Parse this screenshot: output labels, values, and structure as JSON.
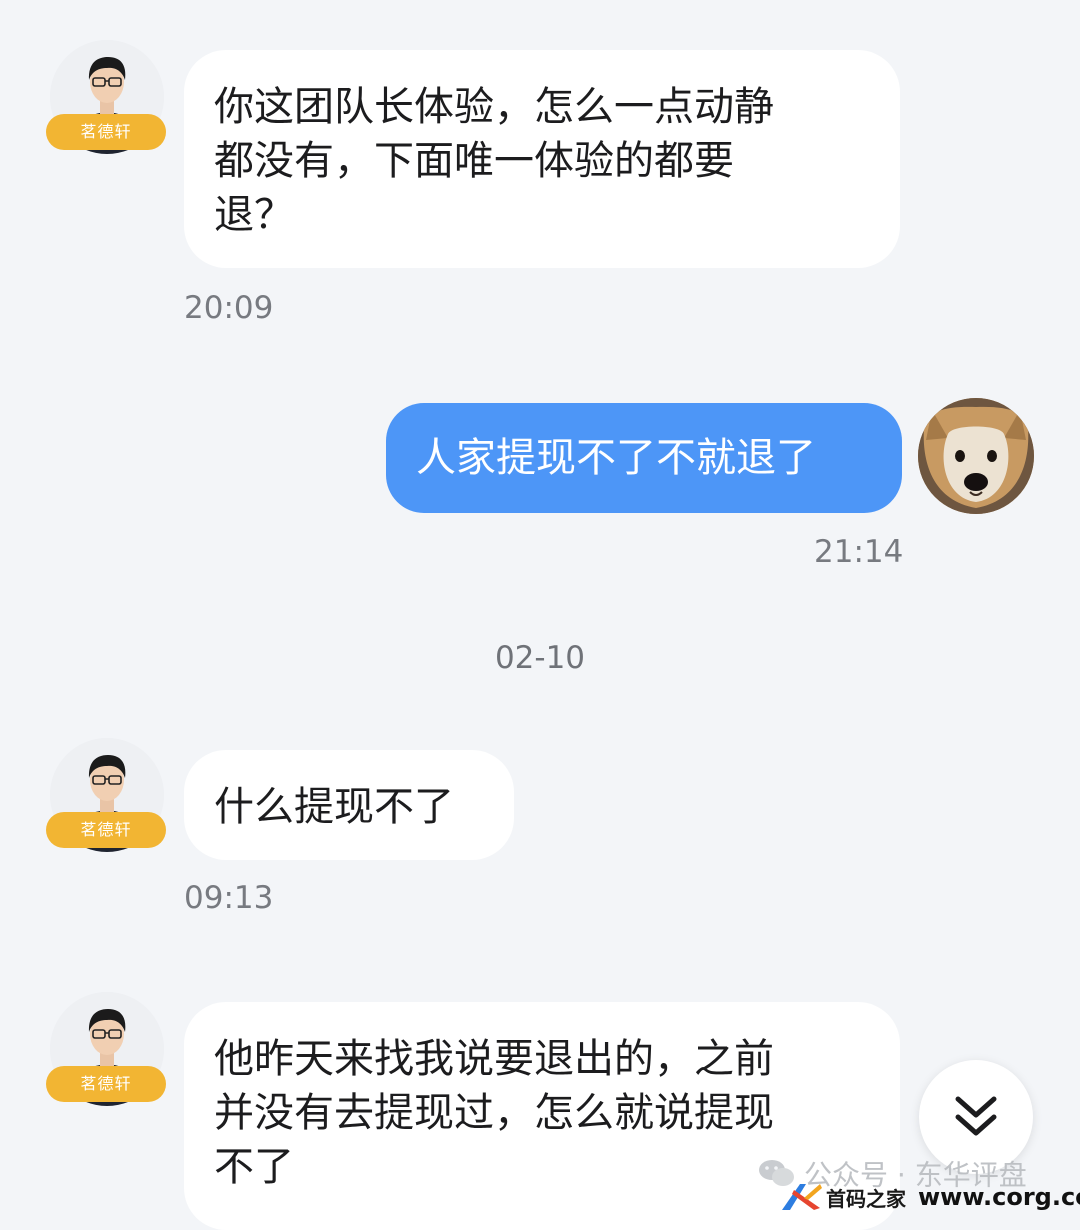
{
  "contact": {
    "name_tag": "茗德轩"
  },
  "messages": [
    {
      "from": "contact",
      "text": "你这团队长体验，怎么一点动静\n都没有，下面唯一体验的都要\n退？",
      "time": "20:09"
    },
    {
      "from": "self",
      "text": "人家提现不了不就退了",
      "time": "21:14"
    },
    {
      "from": "contact",
      "text": "什么提现不了",
      "time": "09:13"
    },
    {
      "from": "contact",
      "text": "他昨天来找我说要退出的，之前\n并没有去提现过，怎么就说提现\n不了"
    }
  ],
  "date_separator": "02-10",
  "watermark": {
    "wechat_text": "公众号 · 东华评盘",
    "site_name": "首码之家",
    "site_url": "www.corg.cc"
  },
  "colors": {
    "background": "#f3f5f8",
    "outgoing_bubble": "#4d96f7",
    "incoming_bubble": "#ffffff",
    "name_tag": "#f2b533"
  },
  "icons": {
    "scroll_down": "double-chevron-down-icon",
    "wechat": "wechat-icon"
  }
}
